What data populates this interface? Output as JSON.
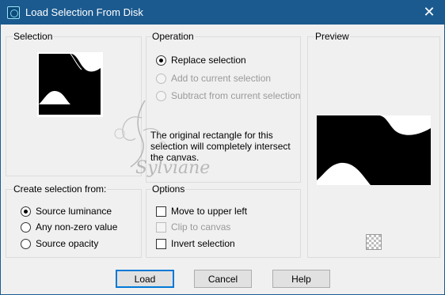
{
  "window": {
    "title": "Load Selection From Disk",
    "close_glyph": "✕",
    "app_icon": "selection-app-icon"
  },
  "selection_group": {
    "label": "Selection"
  },
  "operation": {
    "label": "Operation",
    "options": [
      {
        "label": "Replace selection",
        "checked": true,
        "disabled": false
      },
      {
        "label": "Add to current selection",
        "checked": false,
        "disabled": true
      },
      {
        "label": "Subtract from current selection",
        "checked": false,
        "disabled": true
      }
    ],
    "message": "The original rectangle for this selection will completely intersect the canvas."
  },
  "preview": {
    "label": "Preview",
    "checker_icon": "transparency-checker-icon"
  },
  "create_from": {
    "label": "Create selection from:",
    "options": [
      {
        "label": "Source luminance",
        "checked": true
      },
      {
        "label": "Any non-zero value",
        "checked": false
      },
      {
        "label": "Source opacity",
        "checked": false
      }
    ]
  },
  "options": {
    "label": "Options",
    "items": [
      {
        "label": "Move to upper left",
        "checked": false,
        "disabled": false
      },
      {
        "label": "Clip to canvas",
        "checked": false,
        "disabled": true
      },
      {
        "label": "Invert selection",
        "checked": false,
        "disabled": false
      }
    ]
  },
  "buttons": {
    "load": "Load",
    "cancel": "Cancel",
    "help": "Help"
  },
  "watermark": {
    "text": "Sylviane"
  }
}
